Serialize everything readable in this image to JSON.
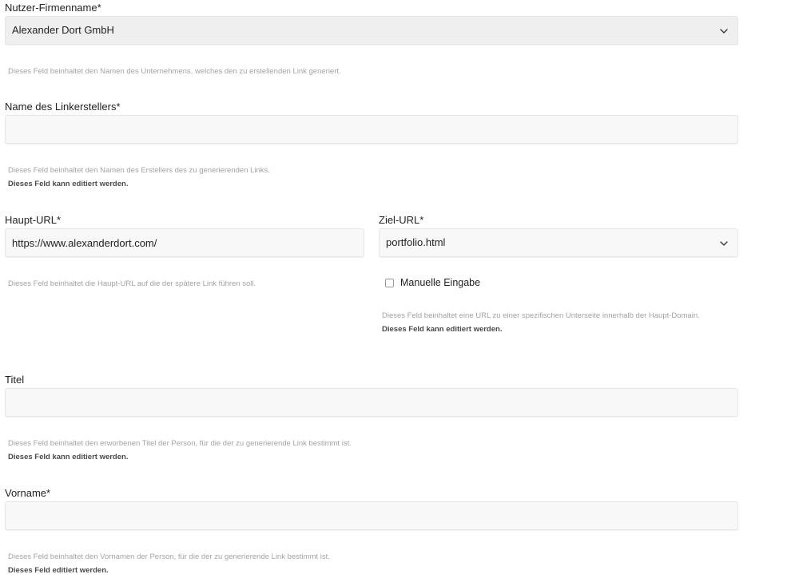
{
  "company": {
    "label": "Nutzer-Firmenname*",
    "value": "Alexander Dort GmbH",
    "help": "Dieses Feld beinhaltet den Namen des Unternehmens, welches den zu erstellenden Link generiert."
  },
  "creator": {
    "label": "Name des Linkerstellers*",
    "value": "",
    "help": "Dieses Feld beinhaltet den Namen des Erstellers des zu generierenden Links.",
    "editable_note": "Dieses Feld kann editiert werden."
  },
  "main_url": {
    "label": "Haupt-URL*",
    "value": "https://www.alexanderdort.com/",
    "help": "Dieses Feld beinhaltet die Haupt-URL auf die der spätere Link führen soll."
  },
  "target_url": {
    "label": "Ziel-URL*",
    "value": "portfolio.html",
    "manual_label": "Manuelle Eingabe",
    "manual_checked": false,
    "help": "Dieses Feld beinhaltet eine URL zu einer spezifischen Unterseite innerhalb der Haupt-Domain.",
    "editable_note": "Dieses Feld kann editiert werden."
  },
  "title": {
    "label": "Titel",
    "value": "",
    "help": "Dieses Feld beinhaltet den erworbenen Titel der Person, für die der zu generierende Link bestimmt ist.",
    "editable_note": "Dieses Feld kann editiert werden."
  },
  "firstname": {
    "label": "Vorname*",
    "value": "",
    "help": "Dieses Feld beinhaltet den Vornamen der Person, für die der zu generierende Link bestimmt ist.",
    "editable_note": "Dieses Feld editiert werden."
  },
  "icons": {
    "dropdown": "chevron-down-icon",
    "checkbox": "checkbox-unchecked"
  }
}
